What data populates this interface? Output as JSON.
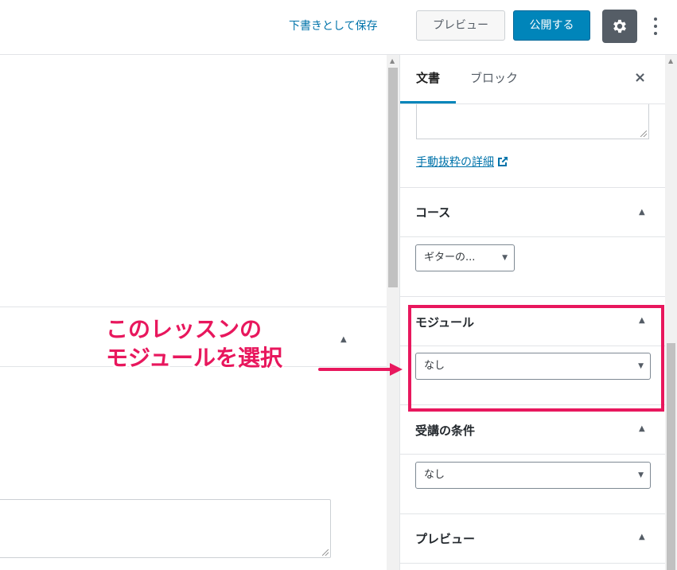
{
  "toolbar": {
    "save_draft": "下書きとして保存",
    "preview": "プレビュー",
    "publish": "公開する"
  },
  "sidebar": {
    "tabs": [
      "文書",
      "ブロック"
    ],
    "close": "×",
    "excerpt_link": "手動抜粋の詳細",
    "panels": {
      "course": {
        "title": "コース",
        "select_value": "ギターの..."
      },
      "module": {
        "title": "モジュール",
        "select_value": "なし"
      },
      "prerequisite": {
        "title": "受講の条件",
        "select_value": "なし"
      },
      "preview": {
        "title": "プレビュー"
      }
    }
  },
  "annotation": {
    "line1": "このレッスンの",
    "line2": "モジュールを選択"
  },
  "colors": {
    "primary": "#0085ba",
    "link": "#0073aa",
    "annotation": "#e8175d",
    "settings_bg": "#555d66"
  }
}
